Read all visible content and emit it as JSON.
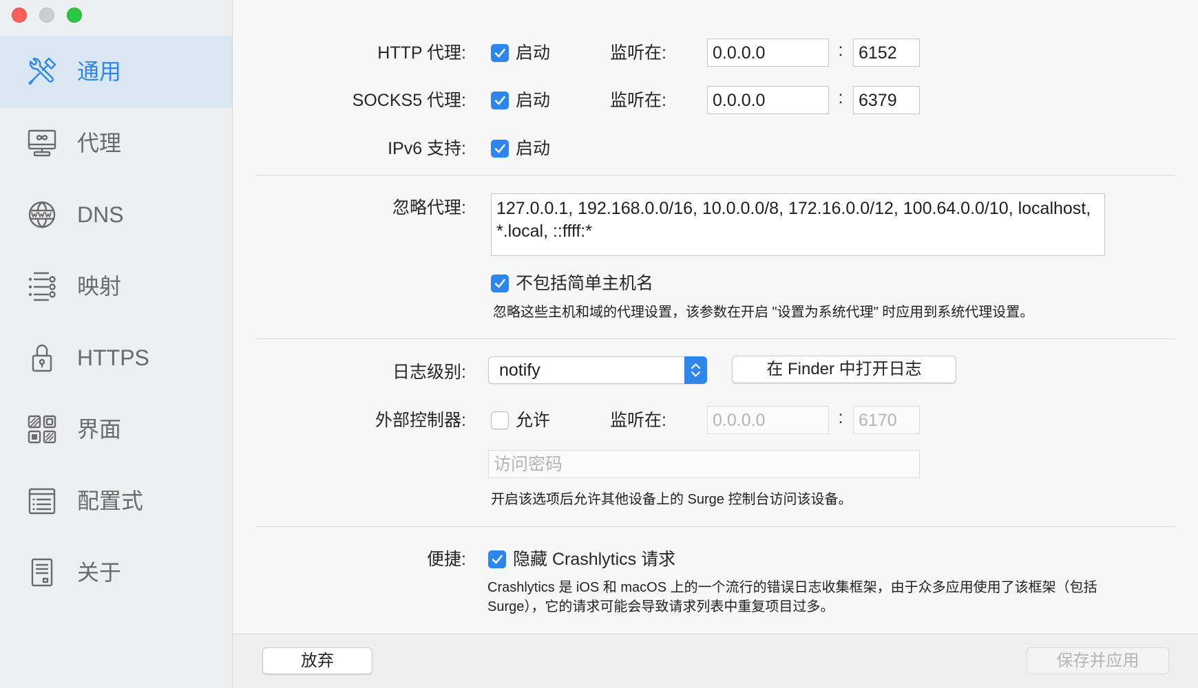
{
  "colors": {
    "accent": "#2c86ee",
    "selected_bg": "#dbe6f3",
    "sidebar_bg": "#eeeff1",
    "close": "#fe5f57",
    "minimize": "#cdcdcd",
    "zoom": "#29c840"
  },
  "sidebar": {
    "items": [
      {
        "label": "通用",
        "icon": "tools-icon",
        "selected": true
      },
      {
        "label": "代理",
        "icon": "monitor-icon",
        "selected": false
      },
      {
        "label": "DNS",
        "icon": "globe-icon",
        "selected": false
      },
      {
        "label": "映射",
        "icon": "list-icon",
        "selected": false
      },
      {
        "label": "HTTPS",
        "icon": "lock-icon",
        "selected": false
      },
      {
        "label": "界面",
        "icon": "grid-icon",
        "selected": false
      },
      {
        "label": "配置式",
        "icon": "config-icon",
        "selected": false
      },
      {
        "label": "关于",
        "icon": "document-icon",
        "selected": false
      }
    ]
  },
  "general": {
    "http_proxy": {
      "label": "HTTP 代理:",
      "enable_label": "启动",
      "enabled": true,
      "listen_label": "监听在:",
      "address": "0.0.0.0",
      "separator": ":",
      "port": "6152"
    },
    "socks5_proxy": {
      "label": "SOCKS5 代理:",
      "enable_label": "启动",
      "enabled": true,
      "listen_label": "监听在:",
      "address": "0.0.0.0",
      "separator": ":",
      "port": "6379"
    },
    "ipv6": {
      "label": "IPv6 支持:",
      "enable_label": "启动",
      "enabled": true
    },
    "bypass": {
      "label": "忽略代理:",
      "value": "127.0.0.1, 192.168.0.0/16, 10.0.0.0/8, 172.16.0.0/12, 100.64.0.0/10, localhost, *.local, ::ffff:*",
      "exclude_simple_label": "不包括简单主机名",
      "exclude_simple_enabled": true,
      "description": "忽略这些主机和域的代理设置，该参数在开启 \"设置为系统代理\" 时应用到系统代理设置。"
    },
    "log_level": {
      "label": "日志级别:",
      "selected": "notify",
      "open_in_finder_label": "在 Finder 中打开日志"
    },
    "external_controller": {
      "label": "外部控制器:",
      "allow_label": "允许",
      "allowed": false,
      "listen_label": "监听在:",
      "address": "0.0.0.0",
      "separator": ":",
      "port": "6170",
      "password_placeholder": "访问密码",
      "description": "开启该选项后允许其他设备上的 Surge 控制台访问该设备。"
    },
    "misc": {
      "label": "便捷:",
      "hide_crashlytics_label": "隐藏 Crashlytics 请求",
      "hide_crashlytics_enabled": true,
      "description": "Crashlytics 是 iOS 和 macOS 上的一个流行的错误日志收集框架，由于众多应用使用了该框架（包括 Surge），它的请求可能会导致请求列表中重复项目过多。"
    }
  },
  "footer": {
    "discard_label": "放弃",
    "save_label": "保存并应用"
  }
}
